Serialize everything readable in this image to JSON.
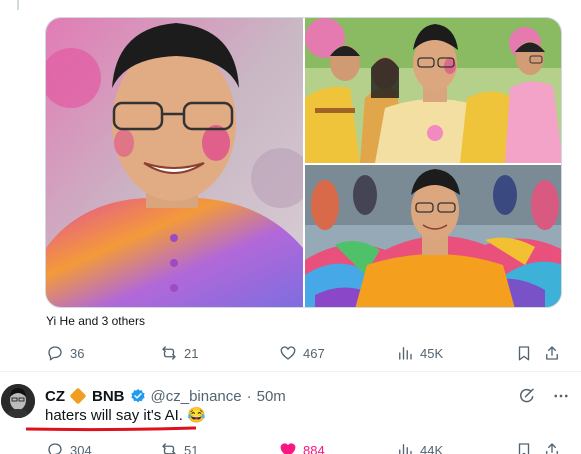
{
  "tweet1": {
    "tagged_text": "Yi He and 3 others",
    "actions": {
      "reply_count": "36",
      "retweet_count": "21",
      "like_count": "467",
      "view_count": "45K"
    }
  },
  "tweet2": {
    "display_name": "CZ",
    "name_suffix": "BNB",
    "handle": "@cz_binance",
    "separator": "·",
    "time": "50m",
    "text": "haters will say it's AI. 😂",
    "actions": {
      "reply_count": "304",
      "retweet_count": "51",
      "like_count": "884",
      "view_count": "44K"
    }
  },
  "colors": {
    "accent_like": "#f91880",
    "verified": "#1d9bf0",
    "underline": "#e0101a",
    "muted": "#536471"
  }
}
